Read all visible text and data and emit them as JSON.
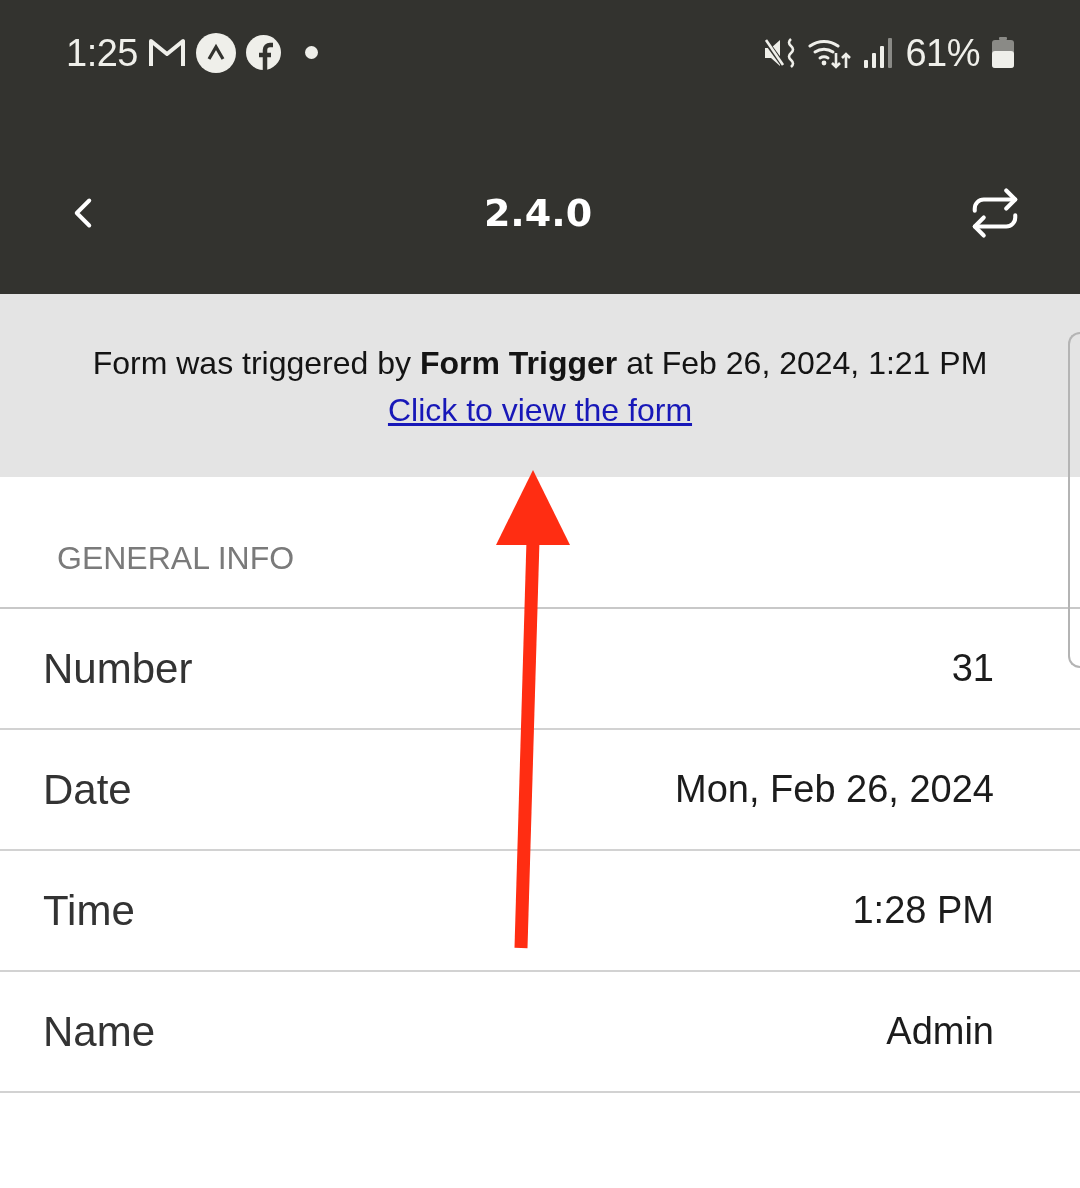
{
  "status_bar": {
    "time": "1:25",
    "battery": "61%"
  },
  "app_bar": {
    "title": "2.4.0"
  },
  "banner": {
    "message": "Form was triggered by **Form Trigger** at Feb 26, 2024, 1:21 PM",
    "link": "Click to view the form"
  },
  "general_info": {
    "title": "GENERAL INFO",
    "rows": [
      {
        "label": "Number",
        "value": "31"
      },
      {
        "label": "Date",
        "value": "Mon, Feb 26, 2024"
      },
      {
        "label": "Time",
        "value": "1:28 PM"
      },
      {
        "label": "Name",
        "value": "Admin"
      }
    ]
  }
}
